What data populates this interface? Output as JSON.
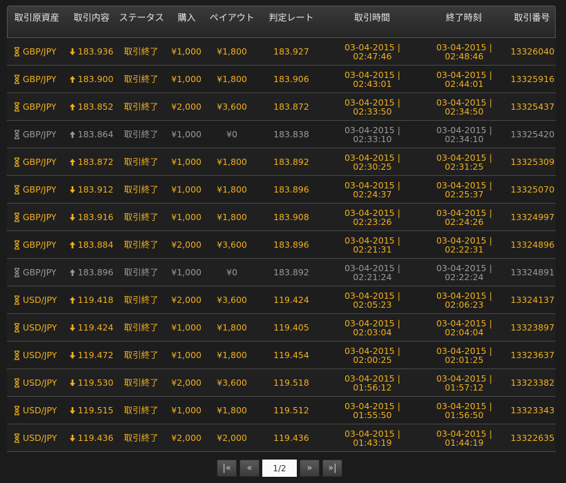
{
  "colors": {
    "active": "#f2b01e",
    "inactive": "#9a9a9a",
    "background": "#1b1b1b"
  },
  "headers": [
    "取引原資産",
    "取引内容",
    "ステータス",
    "購入",
    "ペイアウト",
    "判定レート",
    "取引時間",
    "終了時刻",
    "取引番号"
  ],
  "rows": [
    {
      "asset": "GBP/JPY",
      "dir": "down",
      "rate": "183.936",
      "status": "取引終了",
      "buy": "¥1,000",
      "payout": "¥1,800",
      "judge": "183.927",
      "time_d": "03-04-2015 |",
      "time_t": "02:47:46",
      "end_d": "03-04-2015 |",
      "end_t": "02:48:46",
      "id": "13326040",
      "grey": false
    },
    {
      "asset": "GBP/JPY",
      "dir": "up",
      "rate": "183.900",
      "status": "取引終了",
      "buy": "¥1,000",
      "payout": "¥1,800",
      "judge": "183.906",
      "time_d": "03-04-2015 |",
      "time_t": "02:43:01",
      "end_d": "03-04-2015 |",
      "end_t": "02:44:01",
      "id": "13325916",
      "grey": false
    },
    {
      "asset": "GBP/JPY",
      "dir": "up",
      "rate": "183.852",
      "status": "取引終了",
      "buy": "¥2,000",
      "payout": "¥3,600",
      "judge": "183.872",
      "time_d": "03-04-2015 |",
      "time_t": "02:33:50",
      "end_d": "03-04-2015 |",
      "end_t": "02:34:50",
      "id": "13325437",
      "grey": false
    },
    {
      "asset": "GBP/JPY",
      "dir": "up",
      "rate": "183.864",
      "status": "取引終了",
      "buy": "¥1,000",
      "payout": "¥0",
      "judge": "183.838",
      "time_d": "03-04-2015 |",
      "time_t": "02:33:10",
      "end_d": "03-04-2015 |",
      "end_t": "02:34:10",
      "id": "13325420",
      "grey": true
    },
    {
      "asset": "GBP/JPY",
      "dir": "up",
      "rate": "183.872",
      "status": "取引終了",
      "buy": "¥1,000",
      "payout": "¥1,800",
      "judge": "183.892",
      "time_d": "03-04-2015 |",
      "time_t": "02:30:25",
      "end_d": "03-04-2015 |",
      "end_t": "02:31:25",
      "id": "13325309",
      "grey": false
    },
    {
      "asset": "GBP/JPY",
      "dir": "down",
      "rate": "183.912",
      "status": "取引終了",
      "buy": "¥1,000",
      "payout": "¥1,800",
      "judge": "183.896",
      "time_d": "03-04-2015 |",
      "time_t": "02:24:37",
      "end_d": "03-04-2015 |",
      "end_t": "02:25:37",
      "id": "13325070",
      "grey": false
    },
    {
      "asset": "GBP/JPY",
      "dir": "down",
      "rate": "183.916",
      "status": "取引終了",
      "buy": "¥1,000",
      "payout": "¥1,800",
      "judge": "183.908",
      "time_d": "03-04-2015 |",
      "time_t": "02:23:26",
      "end_d": "03-04-2015 |",
      "end_t": "02:24:26",
      "id": "13324997",
      "grey": false
    },
    {
      "asset": "GBP/JPY",
      "dir": "up",
      "rate": "183.884",
      "status": "取引終了",
      "buy": "¥2,000",
      "payout": "¥3,600",
      "judge": "183.896",
      "time_d": "03-04-2015 |",
      "time_t": "02:21:31",
      "end_d": "03-04-2015 |",
      "end_t": "02:22:31",
      "id": "13324896",
      "grey": false
    },
    {
      "asset": "GBP/JPY",
      "dir": "up",
      "rate": "183.896",
      "status": "取引終了",
      "buy": "¥1,000",
      "payout": "¥0",
      "judge": "183.892",
      "time_d": "03-04-2015 |",
      "time_t": "02:21:24",
      "end_d": "03-04-2015 |",
      "end_t": "02:22:24",
      "id": "13324891",
      "grey": true
    },
    {
      "asset": "USD/JPY",
      "dir": "up",
      "rate": "119.418",
      "status": "取引終了",
      "buy": "¥2,000",
      "payout": "¥3,600",
      "judge": "119.424",
      "time_d": "03-04-2015 |",
      "time_t": "02:05:23",
      "end_d": "03-04-2015 |",
      "end_t": "02:06:23",
      "id": "13324137",
      "grey": false
    },
    {
      "asset": "USD/JPY",
      "dir": "down",
      "rate": "119.424",
      "status": "取引終了",
      "buy": "¥1,000",
      "payout": "¥1,800",
      "judge": "119.405",
      "time_d": "03-04-2015 |",
      "time_t": "02:03:04",
      "end_d": "03-04-2015 |",
      "end_t": "02:04:04",
      "id": "13323897",
      "grey": false
    },
    {
      "asset": "USD/JPY",
      "dir": "down",
      "rate": "119.472",
      "status": "取引終了",
      "buy": "¥1,000",
      "payout": "¥1,800",
      "judge": "119.454",
      "time_d": "03-04-2015 |",
      "time_t": "02:00:25",
      "end_d": "03-04-2015 |",
      "end_t": "02:01:25",
      "id": "13323637",
      "grey": false
    },
    {
      "asset": "USD/JPY",
      "dir": "down",
      "rate": "119.530",
      "status": "取引終了",
      "buy": "¥2,000",
      "payout": "¥3,600",
      "judge": "119.518",
      "time_d": "03-04-2015 |",
      "time_t": "01:56:12",
      "end_d": "03-04-2015 |",
      "end_t": "01:57:12",
      "id": "13323382",
      "grey": false
    },
    {
      "asset": "USD/JPY",
      "dir": "down",
      "rate": "119.515",
      "status": "取引終了",
      "buy": "¥1,000",
      "payout": "¥1,800",
      "judge": "119.512",
      "time_d": "03-04-2015 |",
      "time_t": "01:55:50",
      "end_d": "03-04-2015 |",
      "end_t": "01:56:50",
      "id": "13323343",
      "grey": false
    },
    {
      "asset": "USD/JPY",
      "dir": "down",
      "rate": "119.436",
      "status": "取引終了",
      "buy": "¥2,000",
      "payout": "¥2,000",
      "judge": "119.436",
      "time_d": "03-04-2015 |",
      "time_t": "01:43:19",
      "end_d": "03-04-2015 |",
      "end_t": "01:44:19",
      "id": "13322635",
      "grey": false
    }
  ],
  "pager": {
    "first_icon": "first-page-icon",
    "prev_icon": "prev-page-icon",
    "page": "1/2",
    "next_icon": "next-page-icon",
    "last_icon": "last-page-icon"
  }
}
